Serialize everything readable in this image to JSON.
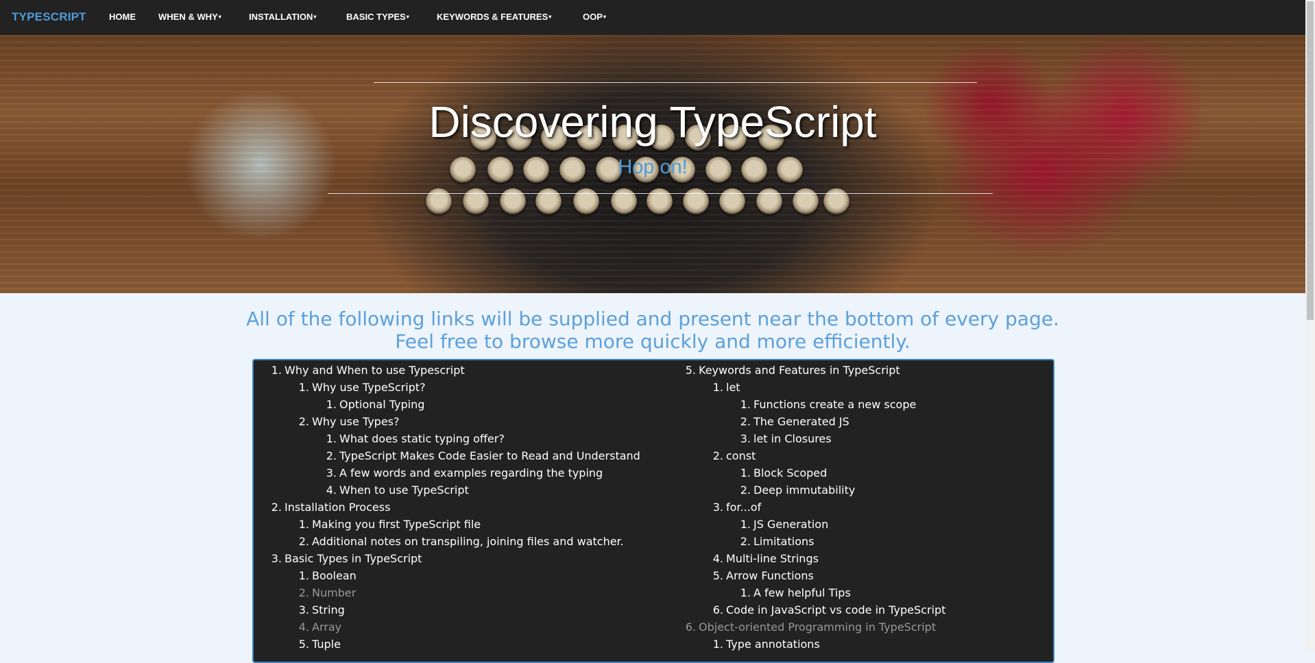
{
  "navbar": {
    "brand": "TYPESCRIPT",
    "items": [
      {
        "label": "HOME",
        "caret": ""
      },
      {
        "label": "WHEN & WHY",
        "caret": "▾"
      },
      {
        "label": "INSTALLATION",
        "caret": "▾"
      },
      {
        "label": "BASIC TYPES",
        "caret": "▾"
      },
      {
        "label": "KEYWORDS & FEATURES",
        "caret": "▾"
      },
      {
        "label": "OOP",
        "caret": "▾"
      }
    ]
  },
  "hero": {
    "title": "Discovering TypeScript",
    "subtitle": "Hop on!"
  },
  "intro": {
    "line1": "All of the following links will be supplied and present near the bottom of every page.",
    "line2": "Feel free to browse more quickly and more efficiently."
  },
  "toc": {
    "left": [
      {
        "num": "1.",
        "label": "Why and When to use Typescript",
        "level": 1,
        "muted": false
      },
      {
        "num": "1.",
        "label": "Why use TypeScript?",
        "level": 2,
        "muted": false
      },
      {
        "num": "1.",
        "label": "Optional Typing",
        "level": 3,
        "muted": false
      },
      {
        "num": "2.",
        "label": "Why use Types?",
        "level": 2,
        "muted": false
      },
      {
        "num": "1.",
        "label": "What does static typing offer?",
        "level": 3,
        "muted": false
      },
      {
        "num": "2.",
        "label": "TypeScript Makes Code Easier to Read and Understand",
        "level": 3,
        "muted": false
      },
      {
        "num": "3.",
        "label": "A few words and examples regarding the typing",
        "level": 3,
        "muted": false
      },
      {
        "num": "4.",
        "label": "When to use TypeScript",
        "level": 3,
        "muted": false
      },
      {
        "num": "2.",
        "label": "Installation Process",
        "level": 1,
        "muted": false
      },
      {
        "num": "1.",
        "label": "Making you first TypeScript file",
        "level": 2,
        "muted": false
      },
      {
        "num": "2.",
        "label": "Additional notes on transpiling, joining files and watcher.",
        "level": 2,
        "muted": false
      },
      {
        "num": "3.",
        "label": "Basic Types in TypeScript",
        "level": 1,
        "muted": false
      },
      {
        "num": "1.",
        "label": "Boolean",
        "level": 2,
        "muted": false
      },
      {
        "num": "2.",
        "label": "Number",
        "level": 2,
        "muted": true
      },
      {
        "num": "3.",
        "label": "String",
        "level": 2,
        "muted": false
      },
      {
        "num": "4.",
        "label": "Array",
        "level": 2,
        "muted": true
      },
      {
        "num": "5.",
        "label": "Tuple",
        "level": 2,
        "muted": false
      }
    ],
    "right": [
      {
        "num": "5.",
        "label": "Keywords and Features in TypeScript",
        "level": 1,
        "muted": false
      },
      {
        "num": "1.",
        "label": "let",
        "level": 2,
        "muted": false
      },
      {
        "num": "1.",
        "label": "Functions create a new scope",
        "level": 3,
        "muted": false
      },
      {
        "num": "2.",
        "label": "The Generated JS",
        "level": 3,
        "muted": false
      },
      {
        "num": "3.",
        "label": "let in Closures",
        "level": 3,
        "muted": false
      },
      {
        "num": "2.",
        "label": "const",
        "level": 2,
        "muted": false
      },
      {
        "num": "1.",
        "label": "Block Scoped",
        "level": 3,
        "muted": false
      },
      {
        "num": "2.",
        "label": "Deep immutability",
        "level": 3,
        "muted": false
      },
      {
        "num": "3.",
        "label": "for...of",
        "level": 2,
        "muted": false
      },
      {
        "num": "1.",
        "label": "JS Generation",
        "level": 3,
        "muted": false
      },
      {
        "num": "2.",
        "label": "Limitations",
        "level": 3,
        "muted": false
      },
      {
        "num": "4.",
        "label": "Multi-line Strings",
        "level": 2,
        "muted": false
      },
      {
        "num": "5.",
        "label": "Arrow Functions",
        "level": 2,
        "muted": false
      },
      {
        "num": "1.",
        "label": "A few helpful Tips",
        "level": 3,
        "muted": false
      },
      {
        "num": "6.",
        "label": "Code in JavaScript vs code in TypeScript",
        "level": 2,
        "muted": false
      },
      {
        "num": "6.",
        "label": "Object-oriented Programming in TypeScript",
        "level": 1,
        "muted": true
      },
      {
        "num": "1.",
        "label": "Type annotations",
        "level": 2,
        "muted": false
      }
    ]
  }
}
